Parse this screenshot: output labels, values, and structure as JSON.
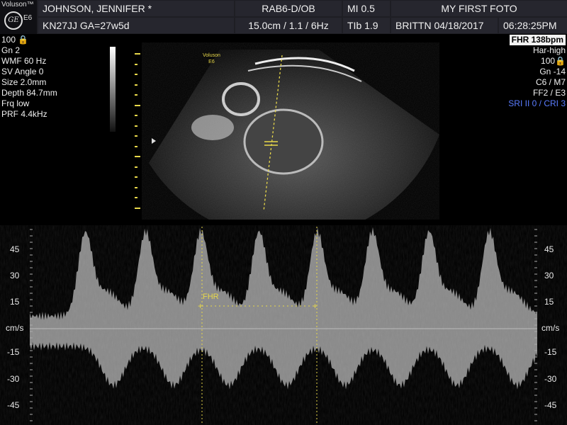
{
  "brand": {
    "name": "Voluson™",
    "logo_text": "GE",
    "model": "E6"
  },
  "header": {
    "patient_name": "JOHNSON, JENNIFER *",
    "probe": "RAB6-D/OB",
    "mi": "MI  0.5",
    "title": "MY FIRST FOTO",
    "patient_id": "KN27JJ  GA=27w5d",
    "depth_info": "15.0cm / 1.1 /  6Hz",
    "tib": "TIb  1.9",
    "operator_date": "BRITTN  04/18/2017",
    "time": "06:28:25PM"
  },
  "left_params": [
    "100 🔒",
    "Gn  2",
    "WMF 60 Hz",
    "SV Angle  0",
    "Size  2.0mm",
    "Depth 84.7mm",
    "Frq low",
    "PRF  4.4kHz"
  ],
  "right_params": {
    "fhr": "FHR 138bpm",
    "items": [
      "Har-high",
      "100🔒",
      "Gn -14",
      "C6 / M7",
      "FF2 / E3"
    ],
    "sri": "SRI II 0 / CRI 3"
  },
  "bmode_overlay": {
    "line1": "Voluson",
    "line2": "E6"
  },
  "doppler": {
    "ticks": [
      "45",
      "30",
      "15",
      "cm/s",
      "-15",
      "-30",
      "-45"
    ],
    "fhr_label": "FHR"
  },
  "colors": {
    "accent": "#e8d84a",
    "header_bg": "#26262e",
    "sri_blue": "#5a7cff"
  }
}
